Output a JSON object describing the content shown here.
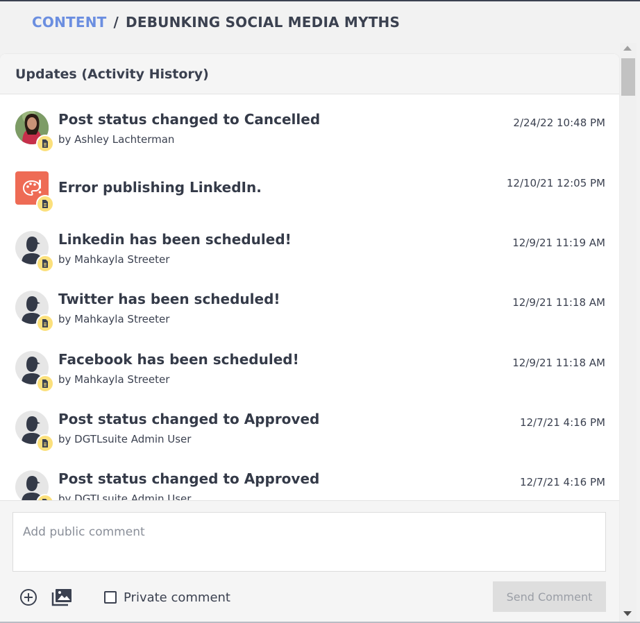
{
  "breadcrumb": {
    "section": "CONTENT",
    "separator": "/",
    "current": "DEBUNKING SOCIAL MEDIA MYTHS"
  },
  "panel": {
    "title": "Updates (Activity History)"
  },
  "activities": [
    {
      "title": "Post status changed to Cancelled",
      "author": "by Ashley Lachterman",
      "time": "2/24/22 10:48 PM",
      "avatar": "user-photo"
    },
    {
      "title": "Error publishing LinkedIn.",
      "author": "",
      "time": "12/10/21 12:05 PM",
      "avatar": "error-palette-icon"
    },
    {
      "title": "Linkedin has been scheduled!",
      "author": "by Mahkayla Streeter",
      "time": "12/9/21 11:19 AM",
      "avatar": "default-user-icon"
    },
    {
      "title": "Twitter has been scheduled!",
      "author": "by Mahkayla Streeter",
      "time": "12/9/21 11:18 AM",
      "avatar": "default-user-icon"
    },
    {
      "title": "Facebook has been scheduled!",
      "author": "by Mahkayla Streeter",
      "time": "12/9/21 11:18 AM",
      "avatar": "default-user-icon"
    },
    {
      "title": "Post status changed to Approved",
      "author": "by DGTLsuite Admin User",
      "time": "12/7/21 4:16 PM",
      "avatar": "default-user-icon"
    },
    {
      "title": "Post status changed to Approved",
      "author": "by DGTLsuite Admin User",
      "time": "12/7/21 4:16 PM",
      "avatar": "default-user-icon"
    }
  ],
  "composer": {
    "placeholder": "Add public comment",
    "private_label": "Private comment",
    "private_checked": false,
    "send_label": "Send Comment",
    "icons": [
      "add-circle-icon",
      "image-gallery-icon"
    ]
  },
  "colors": {
    "link": "#6b8ee0",
    "text": "#3b4150",
    "badge": "#fbe07c",
    "error_avatar": "#ee6b55",
    "send_disabled_bg": "#dedede"
  }
}
